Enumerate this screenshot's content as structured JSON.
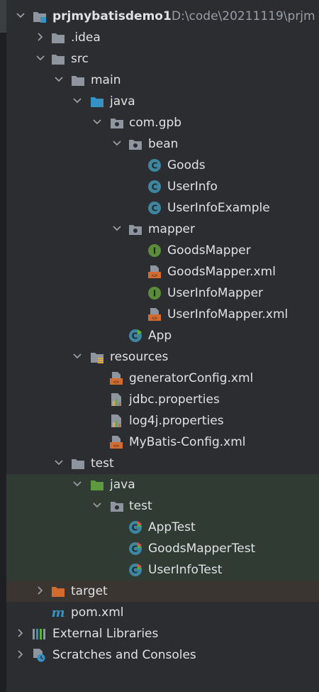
{
  "project_tree": {
    "root": {
      "name": "prjmybatisdemo1",
      "path": "D:\\code\\20211119\\prjm"
    },
    "idea": ".idea",
    "src": "src",
    "main": "main",
    "java": "java",
    "com_gpb": "com.gpb",
    "bean": "bean",
    "goods": "Goods",
    "userinfo": "UserInfo",
    "userinfo_example": "UserInfoExample",
    "mapper": "mapper",
    "goods_mapper": "GoodsMapper",
    "goods_mapper_xml": "GoodsMapper.xml",
    "userinfo_mapper": "UserInfoMapper",
    "userinfo_mapper_xml": "UserInfoMapper.xml",
    "app": "App",
    "resources": "resources",
    "generator_config": "generatorConfig.xml",
    "jdbc_properties": "jdbc.properties",
    "log4j_properties": "log4j.properties",
    "mybatis_config": "MyBatis-Config.xml",
    "test": "test",
    "test_java": "java",
    "test_pkg": "test",
    "app_test": "AppTest",
    "goods_mapper_test": "GoodsMapperTest",
    "userinfo_test": "UserInfoTest",
    "target": "target",
    "pom": "pom.xml",
    "external_libraries": "External Libraries",
    "scratches": "Scratches and Consoles"
  },
  "colors": {
    "background": "#2b2d30",
    "text": "#dfe1e5",
    "folder": "#8f959e",
    "source_folder": "#3592c4",
    "test_folder": "#5c9a3d",
    "excluded_folder": "#d36a2e",
    "class_icon": "#3e86a0",
    "interface_icon": "#5b8c3a",
    "xml_icon": "#d36a2e"
  }
}
